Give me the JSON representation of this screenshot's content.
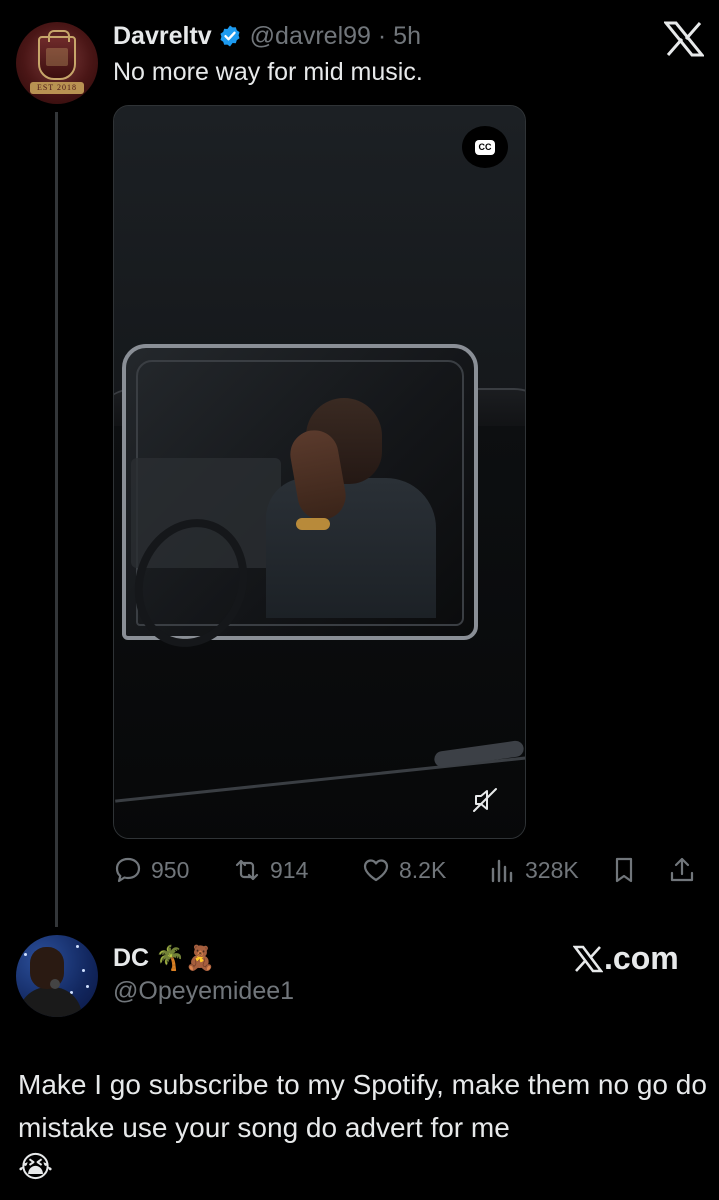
{
  "original_tweet": {
    "display_name": "Davreltv",
    "handle_time": "@davrel99 · 5h",
    "text": "No more way for mid music.",
    "avatar_banner_text": "EST 2018",
    "cc_label": "CC",
    "stats": {
      "replies": "950",
      "reposts": "914",
      "likes": "8.2K",
      "views": "328K"
    }
  },
  "reply": {
    "display_name": "DC",
    "emojis": "🌴🧸",
    "handle": "@Opeyemidee1",
    "text": "Make I go subscribe to my Spotify, make them no go do mistake use your song do advert for me",
    "emoji_line": "😭"
  },
  "watermark": {
    "text": ".com"
  },
  "colors": {
    "background": "#000000",
    "primary_text": "#e7e9ea",
    "secondary_text": "#71767b",
    "verified_blue": "#1d9bf0",
    "thread_line": "#333639"
  }
}
